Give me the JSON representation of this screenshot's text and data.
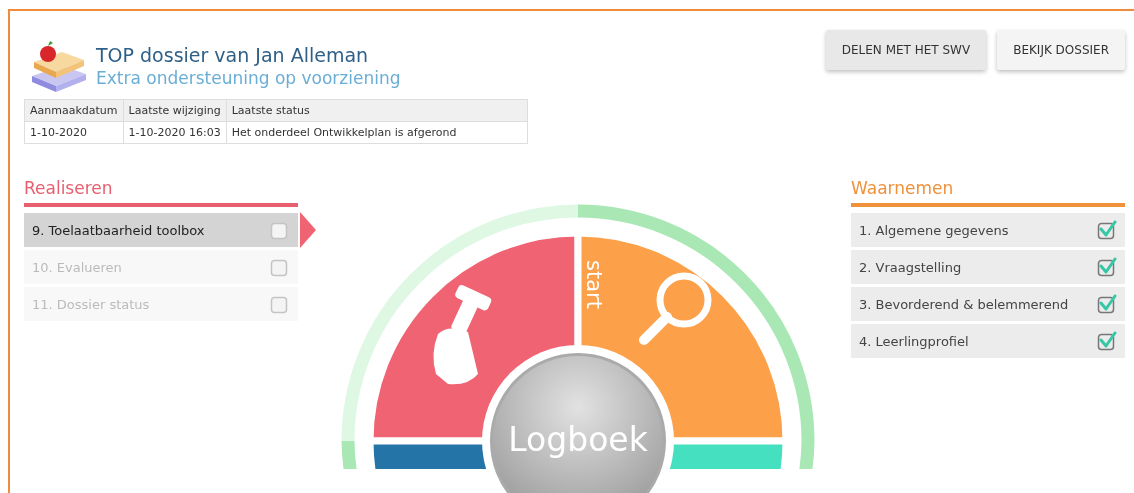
{
  "header": {
    "title": "TOP dossier van Jan Alleman",
    "subtitle": "Extra ondersteuning op voorziening"
  },
  "buttons": [
    {
      "label": "DELEN MET HET SWV"
    },
    {
      "label": "BEKIJK DOSSIER"
    }
  ],
  "table": {
    "columns": [
      "Aanmaakdatum",
      "Laatste wijziging",
      "Laatste status"
    ],
    "rows": [
      [
        "1-10-2020",
        "1-10-2020 16:03",
        "Het onderdeel Ontwikkelplan is afgerond"
      ]
    ]
  },
  "left_panel": {
    "title": "Realiseren",
    "items": [
      {
        "label": "9. Toelaatbaarheid toolbox",
        "selected": true,
        "disabled": false,
        "checked": false
      },
      {
        "label": "10. Evalueren",
        "selected": false,
        "disabled": true,
        "checked": false
      },
      {
        "label": "11. Dossier status",
        "selected": false,
        "disabled": true,
        "checked": false
      }
    ]
  },
  "wheel": {
    "start_label": "start",
    "center_label": "Logboek"
  },
  "right_panel": {
    "title": "Waarnemen",
    "items": [
      {
        "label": "1. Algemene gegevens",
        "selected": false,
        "disabled": false,
        "checked": true
      },
      {
        "label": "2. Vraagstelling",
        "selected": false,
        "disabled": false,
        "checked": true
      },
      {
        "label": "3. Bevorderend & belemmerend",
        "selected": false,
        "disabled": false,
        "checked": true
      },
      {
        "label": "4. Leerlingprofiel",
        "selected": false,
        "disabled": false,
        "checked": true
      }
    ]
  }
}
